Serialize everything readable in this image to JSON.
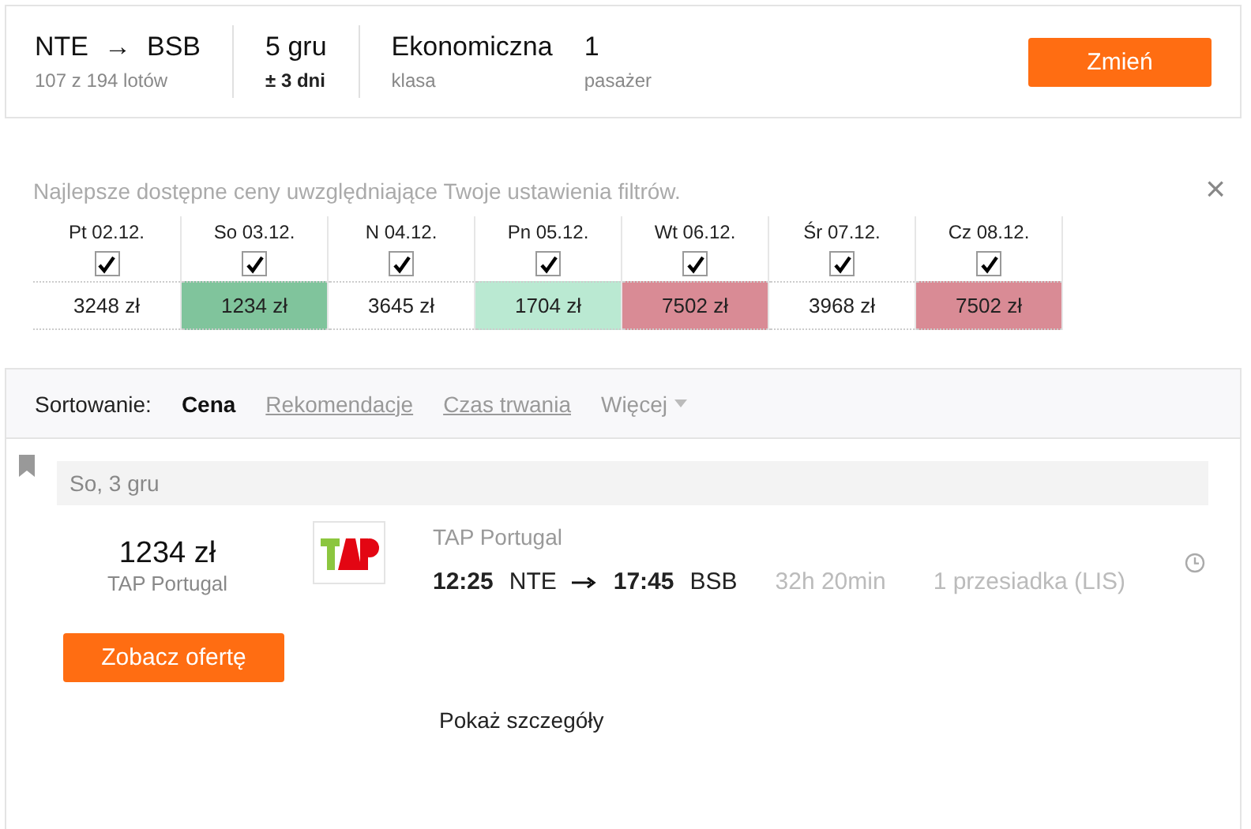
{
  "search": {
    "from": "NTE",
    "arrow": "→",
    "to": "BSB",
    "results": "107 z 194 lotów",
    "date": "5 gru",
    "flex": "± 3 dni",
    "cabin": "Ekonomiczna",
    "cabin_label": "klasa",
    "passengers": "1",
    "passengers_label": "pasażer",
    "button": "Zmień"
  },
  "calendar": {
    "note": "Najlepsze dostępne ceny uwzględniające Twoje ustawienia filtrów.",
    "close": "×",
    "days": [
      {
        "date": "Pt 02.12.",
        "checked": true,
        "price": "3248 zł",
        "color": "#ffffff"
      },
      {
        "date": "So 03.12.",
        "checked": true,
        "price": "1234 zł",
        "color": "#80c49c"
      },
      {
        "date": "N 04.12.",
        "checked": true,
        "price": "3645 zł",
        "color": "#ffffff"
      },
      {
        "date": "Pn 05.12.",
        "checked": true,
        "price": "1704 zł",
        "color": "#bae9d2"
      },
      {
        "date": "Wt 06.12.",
        "checked": true,
        "price": "7502 zł",
        "color": "#d98b95"
      },
      {
        "date": "Śr 07.12.",
        "checked": true,
        "price": "3968 zł",
        "color": "#ffffff"
      },
      {
        "date": "Cz 08.12.",
        "checked": true,
        "price": "7502 zł",
        "color": "#d98b95"
      }
    ]
  },
  "sort": {
    "label": "Sortowanie:",
    "options": [
      {
        "label": "Cena",
        "selected": true,
        "kind": "link"
      },
      {
        "label": "Rekomendacje",
        "selected": false,
        "kind": "link"
      },
      {
        "label": "Czas trwania",
        "selected": false,
        "kind": "link"
      },
      {
        "label": "Więcej",
        "selected": false,
        "kind": "dropdown"
      }
    ]
  },
  "result": {
    "day": "So, 3 gru",
    "price": "1234 zł",
    "airline": "TAP Portugal",
    "airline_title": "TAP Portugal",
    "depart": "12:25",
    "from": "NTE",
    "arrive": "17:45",
    "to": "BSB",
    "duration": "32h 20min",
    "stops": "1 przesiadka (LIS)",
    "offer_button": "Zobacz ofertę",
    "details": "Pokaż szczegóły"
  }
}
